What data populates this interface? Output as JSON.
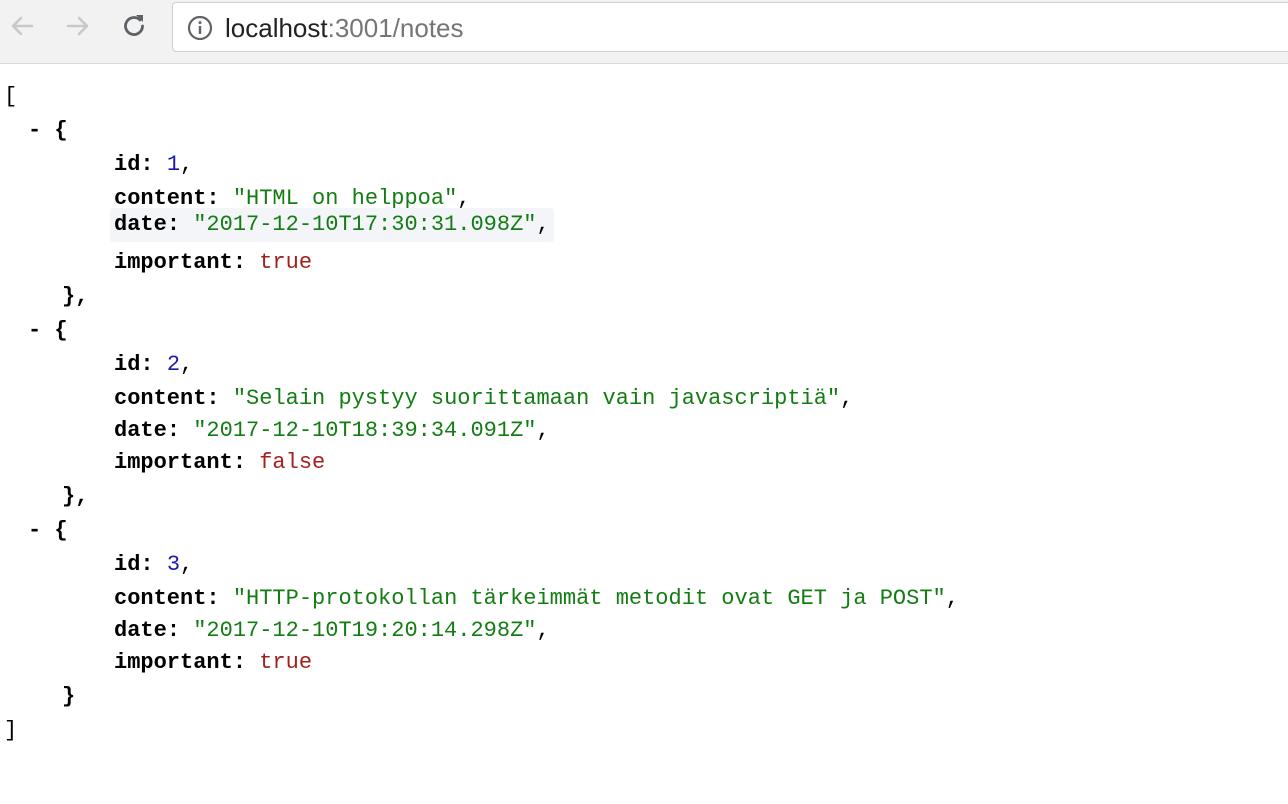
{
  "browser": {
    "url_host": "localhost",
    "url_rest": ":3001/notes"
  },
  "json": {
    "open_bracket": "[",
    "close_bracket": "]",
    "collapse_marker": "-",
    "notes": [
      {
        "id": "1",
        "content": "\"HTML on helppoa\"",
        "date": "\"2017-12-10T17:30:31.098Z\"",
        "important": "true",
        "closing": "},"
      },
      {
        "id": "2",
        "content": "\"Selain pystyy suorittamaan vain javascriptiä\"",
        "date": "\"2017-12-10T18:39:34.091Z\"",
        "important": "false",
        "closing": "},"
      },
      {
        "id": "3",
        "content": "\"HTTP-protokollan tärkeimmät metodit ovat GET ja POST\"",
        "date": "\"2017-12-10T19:20:14.298Z\"",
        "important": "true",
        "closing": "}"
      }
    ],
    "keys": {
      "id": "id",
      "content": "content",
      "date": "date",
      "important": "important"
    }
  },
  "colors": {
    "key": "#000000",
    "number": "#1a1aa6",
    "string": "#137c13",
    "boolean": "#a3201f"
  }
}
